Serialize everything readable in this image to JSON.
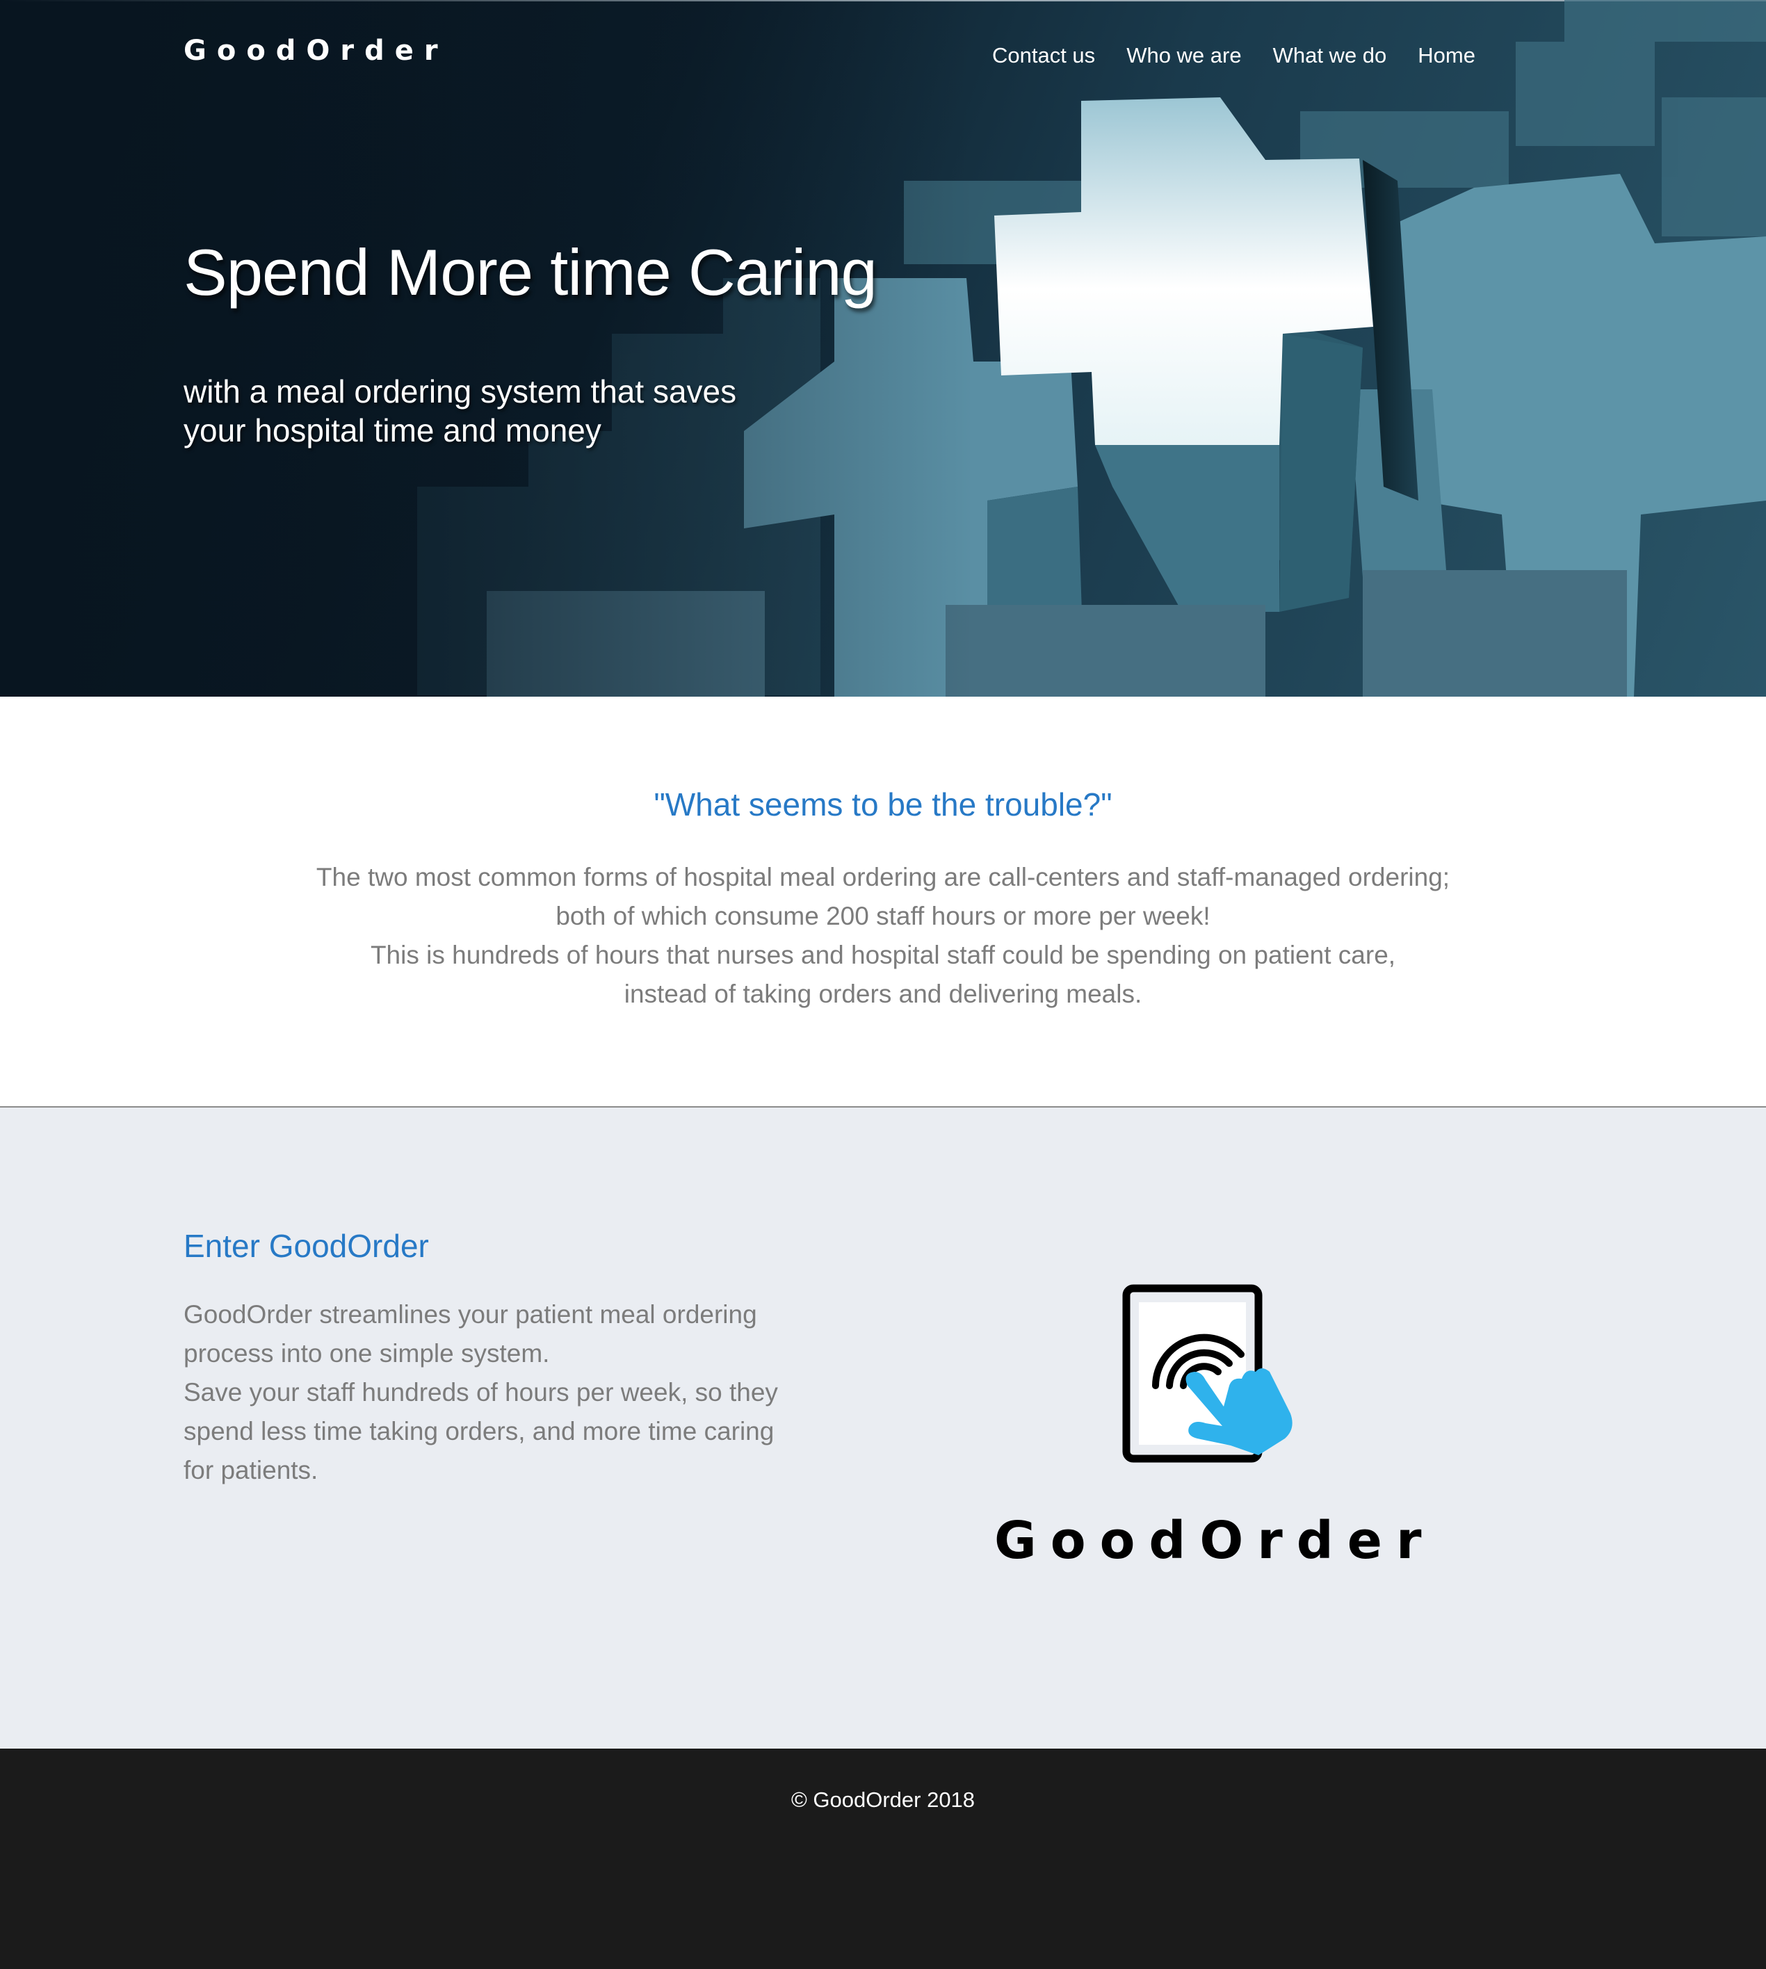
{
  "header": {
    "brand": "GoodOrder",
    "nav": [
      "Contact us",
      "Who we are",
      "What we do",
      "Home"
    ]
  },
  "hero": {
    "title": "Spend More time Caring",
    "subtitle_lines": [
      "with a meal ordering system that saves",
      "your hospital time and money"
    ]
  },
  "trouble": {
    "heading": "\"What seems to be the trouble?\"",
    "lines": [
      "The two most common forms of hospital meal ordering are call-centers and staff-managed ordering;",
      "both of which consume 200 staff hours or more per week!",
      "This is hundreds of hours that nurses and hospital staff could be spending on patient care,",
      "instead of taking orders and delivering meals."
    ]
  },
  "enter": {
    "heading": "Enter GoodOrder",
    "lines": [
      "GoodOrder streamlines your patient meal ordering",
      "process into one simple system.",
      "Save your staff hundreds of hours per week, so they",
      "spend less time taking orders, and more time caring",
      "for patients."
    ],
    "logo_text": "GoodOrder",
    "logo_icon": "tablet-tap-icon"
  },
  "footer": {
    "copyright": "© GoodOrder 2018"
  },
  "colors": {
    "accent_blue": "#2779c6",
    "hand_blue": "#2fb2ec",
    "body_gray": "#7c7c7c",
    "section_bg": "#eaedf2",
    "footer_bg": "#1b1b1b"
  }
}
